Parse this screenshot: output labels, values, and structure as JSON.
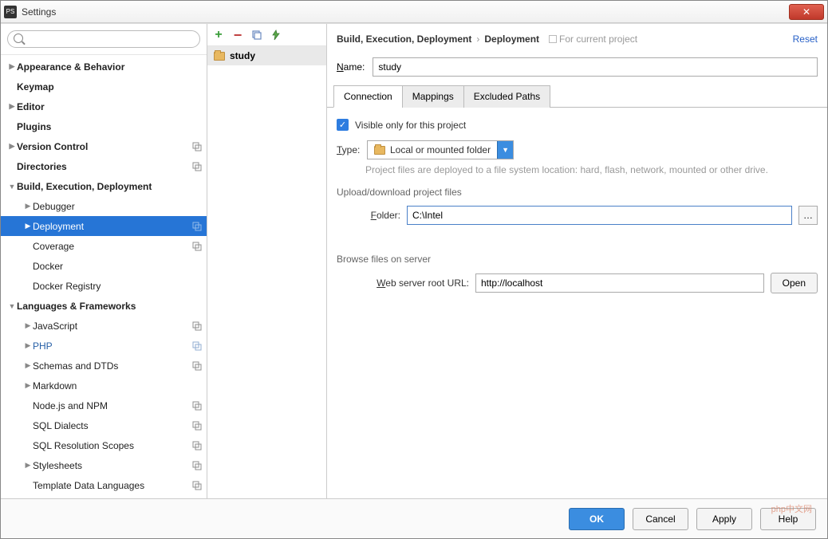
{
  "window": {
    "title": "Settings",
    "app_abbrev": "PS"
  },
  "breadcrumb": {
    "parent": "Build, Execution, Deployment",
    "current": "Deployment",
    "scope_hint": "For current project",
    "reset": "Reset"
  },
  "search": {
    "placeholder": ""
  },
  "tree": {
    "items": [
      {
        "label": "Appearance & Behavior",
        "bold": true,
        "arrow": "▶",
        "indent": 0
      },
      {
        "label": "Keymap",
        "bold": true,
        "indent": 0,
        "noarrow": true
      },
      {
        "label": "Editor",
        "bold": true,
        "arrow": "▶",
        "indent": 0
      },
      {
        "label": "Plugins",
        "bold": true,
        "indent": 0,
        "noarrow": true
      },
      {
        "label": "Version Control",
        "bold": true,
        "arrow": "▶",
        "indent": 0,
        "copy": true
      },
      {
        "label": "Directories",
        "bold": true,
        "indent": 0,
        "noarrow": true,
        "copy": true
      },
      {
        "label": "Build, Execution, Deployment",
        "bold": true,
        "arrow": "▼",
        "indent": 0
      },
      {
        "label": "Debugger",
        "arrow": "▶",
        "indent": 1
      },
      {
        "label": "Deployment",
        "arrow": "▶",
        "indent": 1,
        "selected": true,
        "copy": true
      },
      {
        "label": "Coverage",
        "indent": 1,
        "noarrow": true,
        "copy": true
      },
      {
        "label": "Docker",
        "indent": 1,
        "noarrow": true
      },
      {
        "label": "Docker Registry",
        "indent": 1,
        "noarrow": true
      },
      {
        "label": "Languages & Frameworks",
        "bold": true,
        "arrow": "▼",
        "indent": 0
      },
      {
        "label": "JavaScript",
        "arrow": "▶",
        "indent": 1,
        "copy": true
      },
      {
        "label": "PHP",
        "arrow": "▶",
        "indent": 1,
        "copy": true,
        "link": true
      },
      {
        "label": "Schemas and DTDs",
        "arrow": "▶",
        "indent": 1,
        "copy": true
      },
      {
        "label": "Markdown",
        "arrow": "▶",
        "indent": 1
      },
      {
        "label": "Node.js and NPM",
        "indent": 1,
        "noarrow": true,
        "copy": true
      },
      {
        "label": "SQL Dialects",
        "indent": 1,
        "noarrow": true,
        "copy": true
      },
      {
        "label": "SQL Resolution Scopes",
        "indent": 1,
        "noarrow": true,
        "copy": true
      },
      {
        "label": "Stylesheets",
        "arrow": "▶",
        "indent": 1,
        "copy": true
      },
      {
        "label": "Template Data Languages",
        "indent": 1,
        "noarrow": true,
        "copy": true
      }
    ]
  },
  "servers": {
    "selected": "study"
  },
  "form": {
    "name_label": "Name:",
    "name_value": "study",
    "tabs": [
      "Connection",
      "Mappings",
      "Excluded Paths"
    ],
    "active_tab": 0,
    "visible_only": {
      "checked": true,
      "label": "Visible only for this project"
    },
    "type_label": "Type:",
    "type_value": "Local or mounted folder",
    "type_desc": "Project files are deployed to a file system location: hard, flash, network, mounted or other drive.",
    "upload_section": "Upload/download project files",
    "folder_label": "Folder:",
    "folder_value": "C:\\Intel",
    "browse_section": "Browse files on server",
    "web_url_label": "Web server root URL:",
    "web_url_value": "http://localhost",
    "open_btn": "Open"
  },
  "footer": {
    "ok": "OK",
    "cancel": "Cancel",
    "apply": "Apply",
    "help": "Help"
  },
  "watermark": "php中文网"
}
